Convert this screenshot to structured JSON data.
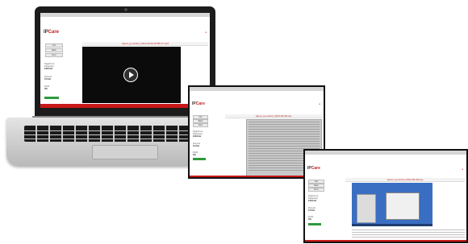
{
  "brand": {
    "logo_prefix": "IP",
    "logo_suffix": "Care"
  },
  "laptop_screen": {
    "title": "raport_ip-control_2014-06-09 09:58:27.mp4",
    "buttons": [
      "Info",
      "Back",
      "Next"
    ],
    "side": [
      "Pojazd roz.",
      "Parametry",
      "Zuzycie",
      "Profil"
    ],
    "values": [
      "1234 km",
      "0.0 km",
      "0%"
    ]
  },
  "monitor_screen": {
    "title": "raport_ip-control_2014-06-09.raw",
    "buttons": [
      "Info",
      "Back",
      "Next"
    ],
    "side": [
      "Pojazd roz.",
      "Parametry",
      "Zuzycie",
      "Profil"
    ],
    "values": [
      "1234 km",
      "0.0 km",
      "0%"
    ]
  },
  "tablet_screen": {
    "title": "raport_ip-control_2014-06-09.png",
    "buttons": [
      "Info",
      "Back",
      "Next"
    ],
    "side": [
      "Pojazd roz.",
      "Parametry",
      "Zuzycie",
      "Profil"
    ],
    "values": [
      "1234 km",
      "0.0 km",
      "0%"
    ]
  },
  "colors": {
    "accent_red": "#c91818",
    "success_green": "#2e9a3c",
    "desktop_blue": "#3a6ec2"
  },
  "icons": [
    "play-icon",
    "camera-icon"
  ]
}
